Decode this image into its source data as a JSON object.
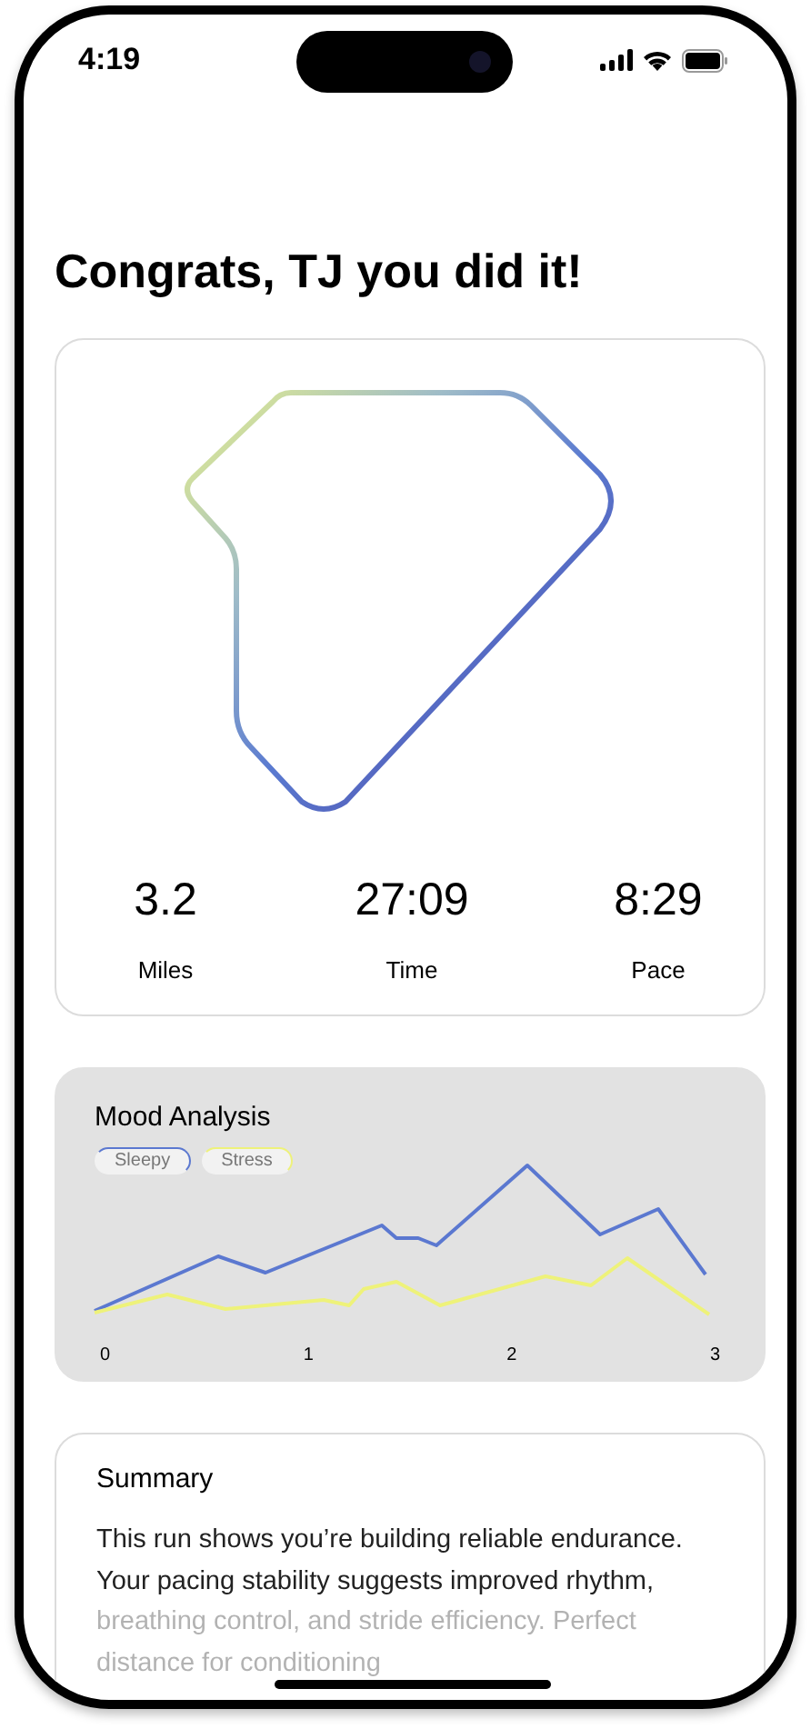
{
  "status_bar": {
    "time": "4:19"
  },
  "title": "Congrats, TJ you did it!",
  "stats": [
    {
      "value": "3.2",
      "label": "Miles"
    },
    {
      "value": "27:09",
      "label": "Time"
    },
    {
      "value": "8:29",
      "label": "Pace"
    }
  ],
  "mood_analysis": {
    "title": "Mood Analysis",
    "legend": [
      {
        "label": "Sleepy",
        "color": "#5b78d0"
      },
      {
        "label": "Stress",
        "color": "#eef27a"
      }
    ],
    "x_labels": [
      "0",
      "1",
      "2",
      "3"
    ]
  },
  "summary": {
    "title": "Summary",
    "text": "This run shows you’re building reliable endurance. Your pacing stability suggests improved rhythm, breathing control, and stride efficiency. Perfect distance for conditioning"
  }
}
